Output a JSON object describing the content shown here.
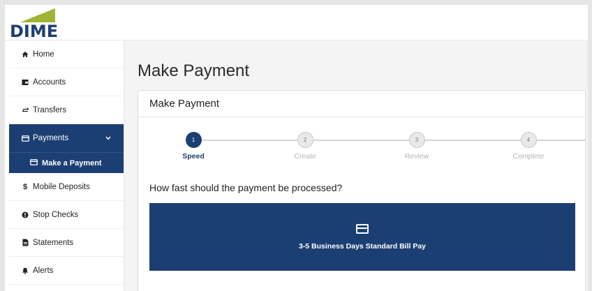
{
  "brand": {
    "logo_text": "DIME",
    "primary_color": "#1c3f73",
    "accent_color": "#9cb533"
  },
  "sidebar": {
    "items": [
      {
        "label": "Home",
        "icon": "home-icon"
      },
      {
        "label": "Accounts",
        "icon": "wallet-icon"
      },
      {
        "label": "Transfers",
        "icon": "transfer-icon"
      },
      {
        "label": "Payments",
        "icon": "credit-card-icon",
        "active": true,
        "expanded": true
      },
      {
        "label": "Mobile Deposits",
        "icon": "dollar-icon"
      },
      {
        "label": "Stop Checks",
        "icon": "alert-circle-icon"
      },
      {
        "label": "Statements",
        "icon": "document-icon"
      },
      {
        "label": "Alerts",
        "icon": "bell-icon"
      }
    ],
    "subitems": [
      {
        "label": "Make a Payment",
        "icon": "credit-card-icon",
        "active": true
      }
    ]
  },
  "main": {
    "page_title": "Make Payment",
    "card_title": "Make Payment",
    "steps": [
      {
        "number": "1",
        "label": "Speed",
        "state": "current"
      },
      {
        "number": "2",
        "label": "Create",
        "state": "upcoming"
      },
      {
        "number": "3",
        "label": "Review",
        "state": "upcoming"
      },
      {
        "number": "4",
        "label": "Complete",
        "state": "upcoming"
      }
    ],
    "question": "How fast should the payment be processed?",
    "options": [
      {
        "label": "3-5 Business Days Standard Bill Pay",
        "icon": "credit-card-icon"
      }
    ]
  }
}
